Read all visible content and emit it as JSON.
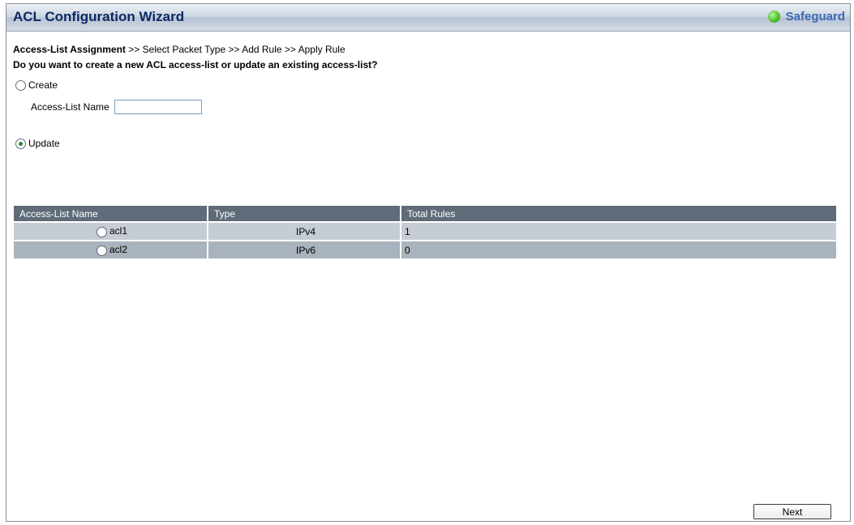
{
  "window": {
    "title": "ACL Configuration Wizard",
    "brand": "Safeguard"
  },
  "breadcrumb": {
    "steps": [
      "Access-List Assignment",
      "Select Packet Type",
      "Add Rule",
      "Apply Rule"
    ],
    "separator": ">>",
    "active_index": 0
  },
  "question": "Do you want to create a new ACL access-list or update an existing access-list?",
  "create_option": {
    "label": "Create",
    "checked": false
  },
  "name_field": {
    "label": "Access-List Name",
    "value": ""
  },
  "update_option": {
    "label": "Update",
    "checked": true
  },
  "table": {
    "headers": [
      "Access-List Name",
      "Type",
      "Total Rules"
    ],
    "rows": [
      {
        "name": "acl1",
        "type": "IPv4",
        "total_rules": "1"
      },
      {
        "name": "acl2",
        "type": "IPv6",
        "total_rules": "0"
      }
    ]
  },
  "next_button": {
    "label": "Next"
  },
  "colors": {
    "title_text": "#0b2a63",
    "brand_text": "#3b6ab0",
    "header_bg": "#5f6b78",
    "row_light": "#c5ccd4",
    "row_dark": "#a9b3be",
    "status_green": "#4bc42d"
  }
}
